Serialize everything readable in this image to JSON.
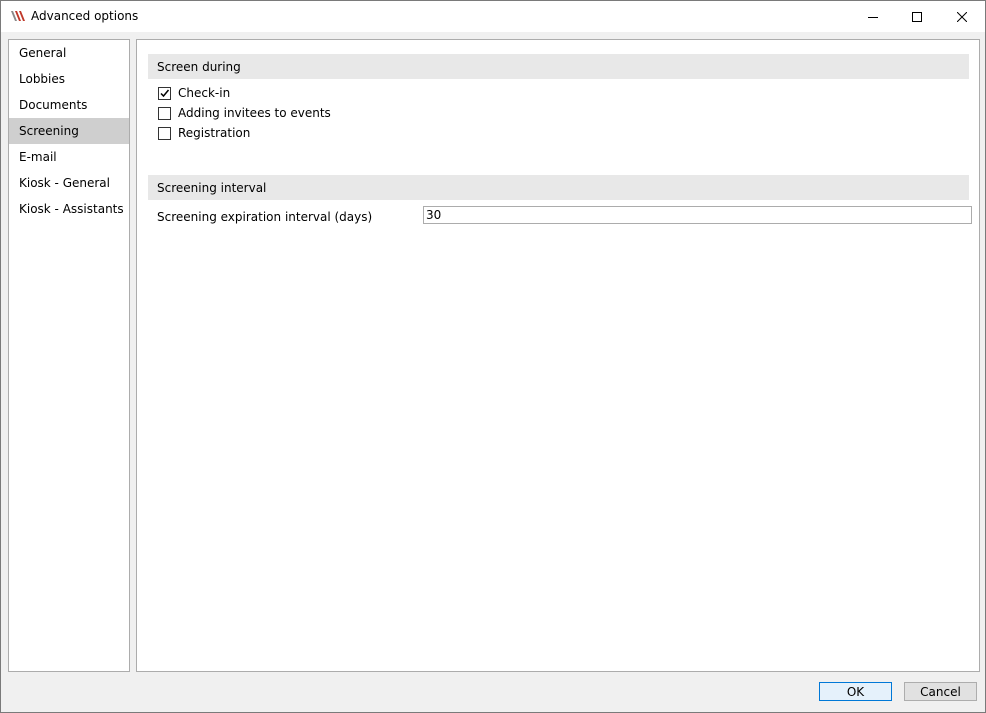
{
  "window": {
    "title": "Advanced options",
    "controls": {
      "minimize": "minimize-icon",
      "maximize": "maximize-icon",
      "close": "close-icon"
    }
  },
  "sidebar": {
    "items": [
      {
        "label": "General",
        "selected": false
      },
      {
        "label": "Lobbies",
        "selected": false
      },
      {
        "label": "Documents",
        "selected": false
      },
      {
        "label": "Screening",
        "selected": true
      },
      {
        "label": "E-mail",
        "selected": false
      },
      {
        "label": "Kiosk - General",
        "selected": false
      },
      {
        "label": "Kiosk - Assistants",
        "selected": false
      }
    ]
  },
  "screen_during": {
    "header": "Screen during",
    "options": [
      {
        "label": "Check-in",
        "checked": true
      },
      {
        "label": "Adding invitees to events",
        "checked": false
      },
      {
        "label": "Registration",
        "checked": false
      }
    ]
  },
  "screening_interval": {
    "header": "Screening interval",
    "field_label": "Screening expiration interval (days)",
    "field_value": "30"
  },
  "footer": {
    "ok_label": "OK",
    "cancel_label": "Cancel"
  },
  "colors": {
    "selected_nav": "#cfcfcf",
    "section_header": "#e8e8e8",
    "default_button_border": "#0078d7",
    "logo_red": "#c0392b"
  }
}
